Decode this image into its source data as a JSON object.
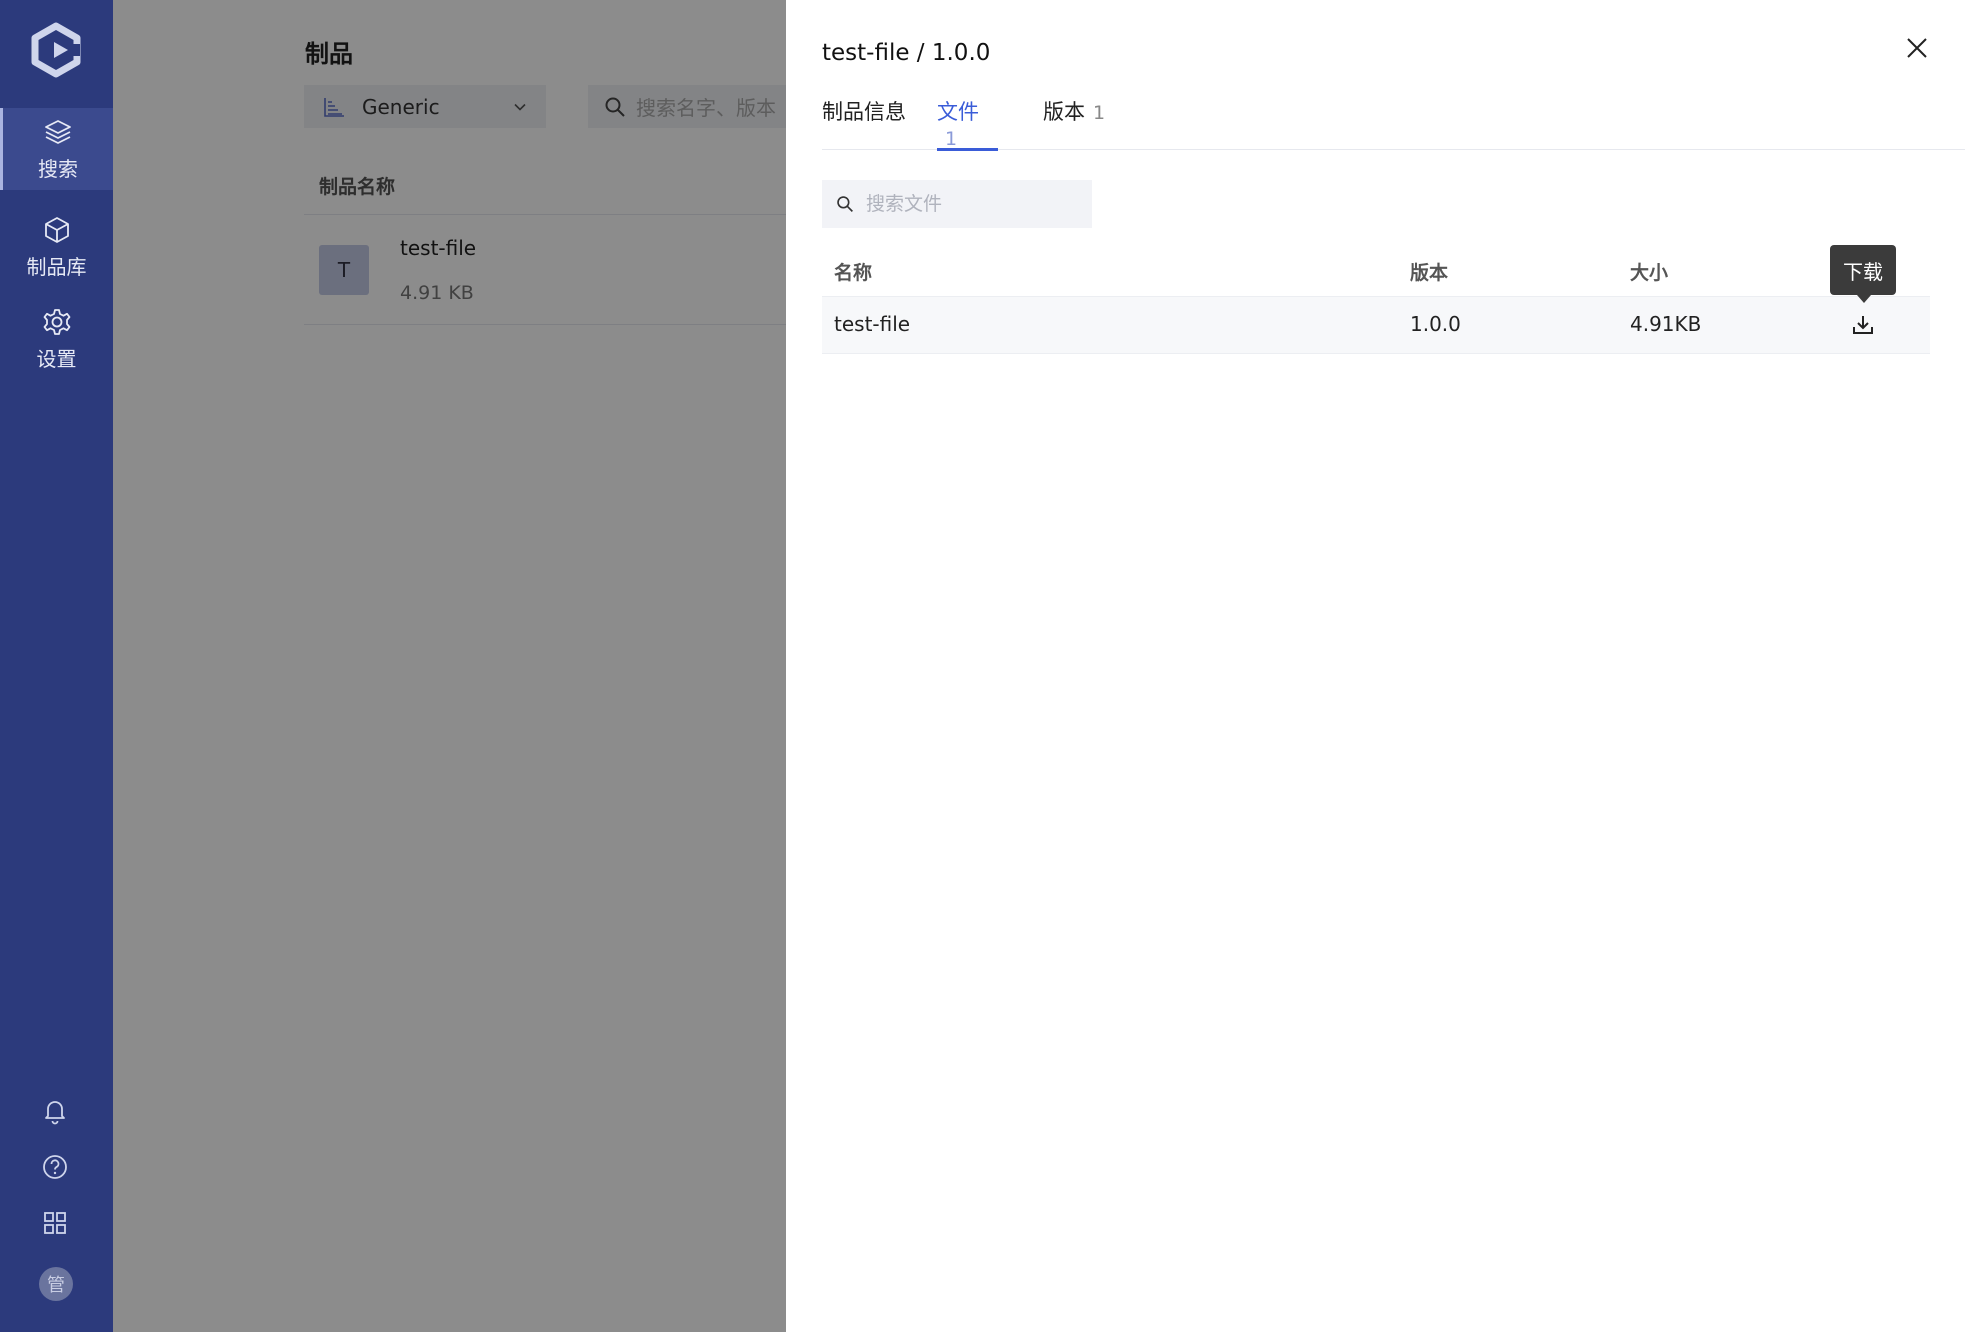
{
  "sidebar": {
    "items": [
      {
        "label": "搜索",
        "icon": "layers-icon",
        "active": true
      },
      {
        "label": "制品库",
        "icon": "cube-icon",
        "active": false
      },
      {
        "label": "设置",
        "icon": "gear-icon",
        "active": false
      }
    ],
    "bottom_icons": [
      "bell-icon",
      "help-icon",
      "apps-grid-icon"
    ],
    "avatar_text": "管"
  },
  "main": {
    "title": "制品",
    "repo_type": "Generic",
    "search_placeholder": "搜索名字、版本",
    "column_header": "制品名称",
    "items": [
      {
        "badge": "T",
        "name": "test-file",
        "size": "4.91 KB"
      }
    ]
  },
  "drawer": {
    "title": "test-file / 1.0.0",
    "tabs": [
      {
        "label": "制品信息",
        "count": ""
      },
      {
        "label": "文件",
        "count": "1"
      },
      {
        "label": "版本",
        "count": "1"
      }
    ],
    "active_tab": "文件",
    "file_search_placeholder": "搜索文件",
    "table": {
      "headers": [
        "名称",
        "版本",
        "大小"
      ],
      "rows": [
        {
          "name": "test-file",
          "version": "1.0.0",
          "size": "4.91KB"
        }
      ]
    },
    "tooltip": "下载"
  },
  "colors": {
    "sidebar_bg": "#2c3a7c",
    "accent": "#3a5cd8"
  }
}
